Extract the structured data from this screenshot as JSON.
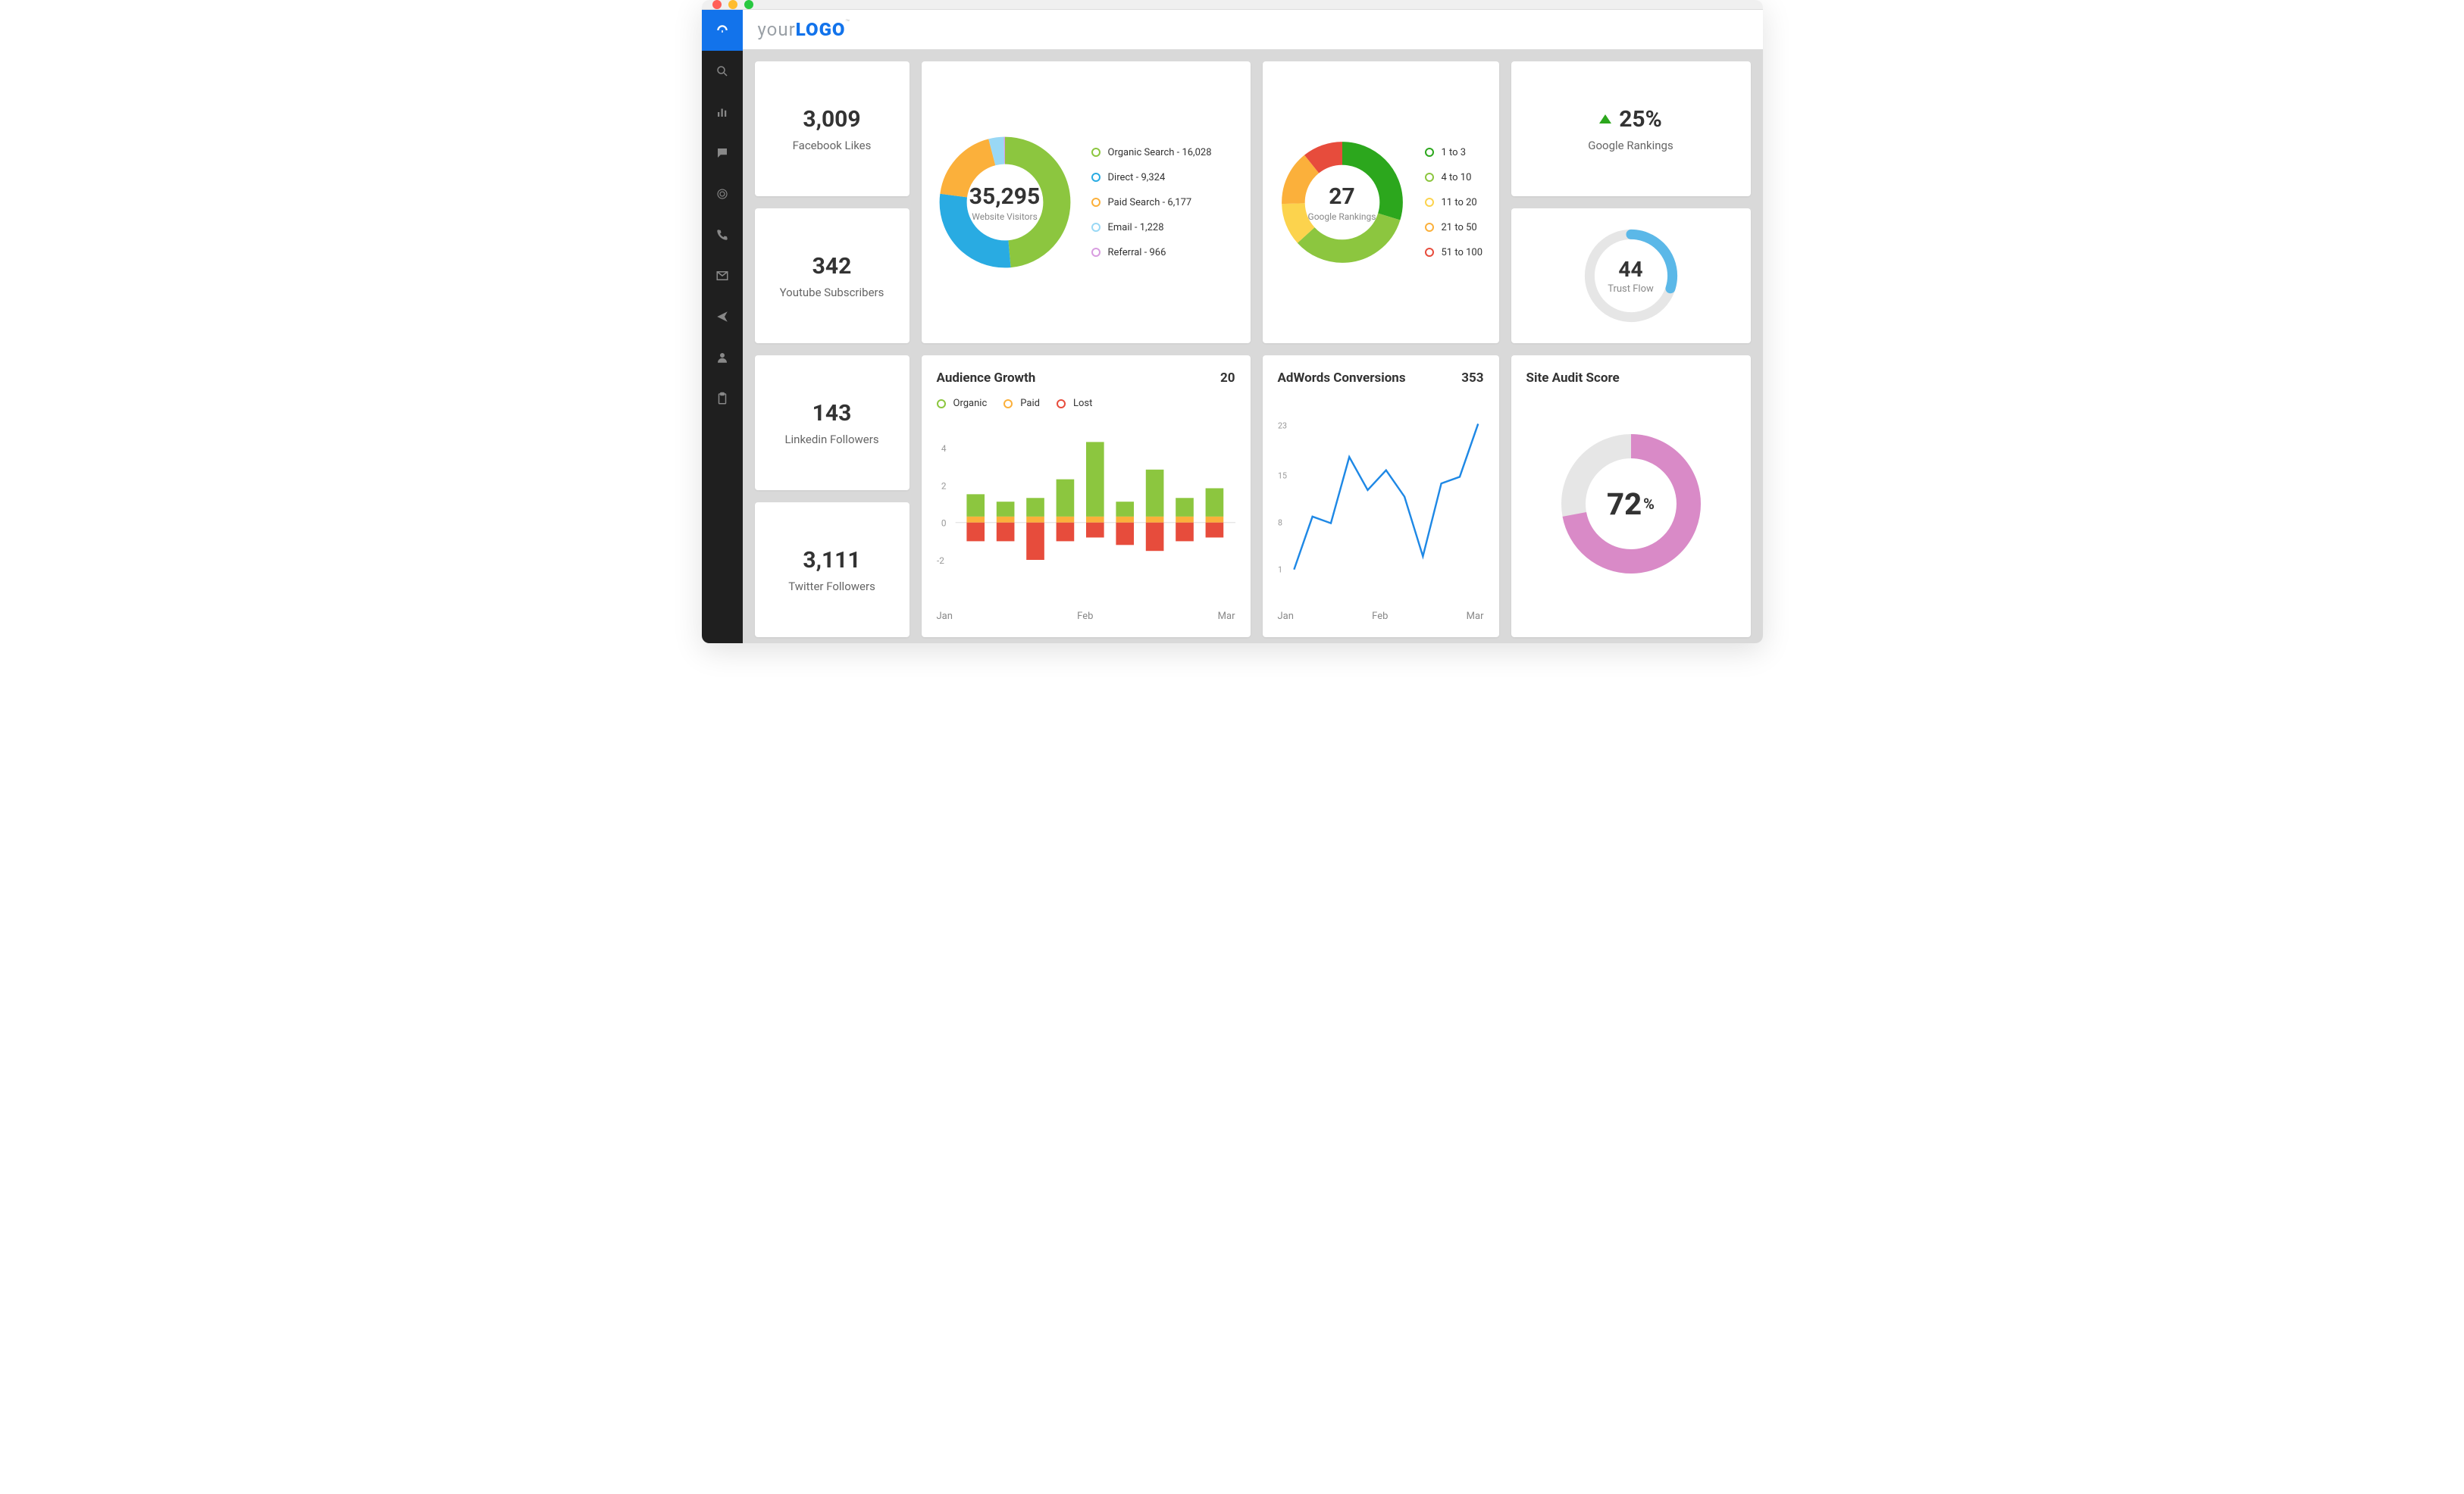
{
  "logo": {
    "prefix": "your",
    "main": "LOGO",
    "tm": "™"
  },
  "stats": {
    "fb": {
      "value": "3,009",
      "label": "Facebook Likes"
    },
    "yt": {
      "value": "342",
      "label": "Youtube Subscribers"
    },
    "li": {
      "value": "143",
      "label": "Linkedin Followers"
    },
    "tw": {
      "value": "3,111",
      "label": "Twitter Followers"
    }
  },
  "website_visitors": {
    "total": "35,295",
    "label": "Website Visitors",
    "items": [
      {
        "label": "Organic Search - 16,028",
        "color": "#8cc63f"
      },
      {
        "label": "Direct - 9,324",
        "color": "#29abe2"
      },
      {
        "label": "Paid Search - 6,177",
        "color": "#fbb03b"
      },
      {
        "label": "Email - 1,228",
        "color": "#99d8f5"
      },
      {
        "label": "Referral - 966",
        "color": "#d89de0"
      }
    ]
  },
  "google_rankings": {
    "total": "27",
    "label": "Google Rankings",
    "items": [
      {
        "label": "1 to 3",
        "color": "#2ca71d"
      },
      {
        "label": "4 to 10",
        "color": "#8cc63f"
      },
      {
        "label": "11 to 20",
        "color": "#fcd34d"
      },
      {
        "label": "21 to 50",
        "color": "#fbb03b"
      },
      {
        "label": "51 to 100",
        "color": "#e74c3c"
      }
    ]
  },
  "rank_change": {
    "value": "25%",
    "label": "Google Rankings"
  },
  "trust_flow": {
    "value": "44",
    "label": "Trust Flow",
    "percent": 30
  },
  "audience_growth": {
    "title": "Audience Growth",
    "value": "20",
    "legend": [
      {
        "label": "Organic",
        "color": "#8cc63f"
      },
      {
        "label": "Paid",
        "color": "#fbb03b"
      },
      {
        "label": "Lost",
        "color": "#e74c3c"
      }
    ],
    "x": [
      "Jan",
      "Feb",
      "Mar"
    ]
  },
  "adwords": {
    "title": "AdWords Conversions",
    "value": "353",
    "x": [
      "Jan",
      "Feb",
      "Mar"
    ],
    "yticks": [
      "23",
      "15",
      "8",
      "1"
    ]
  },
  "site_audit": {
    "title": "Site Audit Score",
    "value": "72",
    "suffix": "%",
    "percent": 72
  },
  "chart_data": [
    {
      "type": "pie",
      "title": "Website Visitors",
      "series": [
        {
          "name": "Organic Search",
          "value": 16028
        },
        {
          "name": "Direct",
          "value": 9324
        },
        {
          "name": "Paid Search",
          "value": 6177
        },
        {
          "name": "Email",
          "value": 1228
        },
        {
          "name": "Referral",
          "value": 966
        }
      ],
      "total": 35295
    },
    {
      "type": "pie",
      "title": "Google Rankings",
      "series": [
        {
          "name": "1 to 3",
          "value": 8
        },
        {
          "name": "4 to 10",
          "value": 9
        },
        {
          "name": "11 to 20",
          "value": 3
        },
        {
          "name": "21 to 50",
          "value": 4
        },
        {
          "name": "51 to 100",
          "value": 3
        }
      ],
      "total": 27
    },
    {
      "type": "bar",
      "title": "Audience Growth",
      "categories": [
        "Jan",
        "",
        "",
        "",
        "Feb",
        "",
        "",
        "",
        "Mar"
      ],
      "series": [
        {
          "name": "Organic",
          "values": [
            1.2,
            0.8,
            1.0,
            2.0,
            4.0,
            0.8,
            2.5,
            1.0,
            1.5
          ]
        },
        {
          "name": "Paid",
          "values": [
            0.3,
            0.3,
            0.3,
            0.3,
            0.3,
            0.3,
            0.3,
            0.3,
            0.3
          ]
        },
        {
          "name": "Lost",
          "values": [
            -1.0,
            -1.0,
            -2.0,
            -1.0,
            -0.8,
            -1.2,
            -1.5,
            -1.0,
            -0.8
          ]
        }
      ],
      "ylim": [
        -2,
        4
      ],
      "xlabel": "",
      "ylabel": ""
    },
    {
      "type": "line",
      "title": "AdWords Conversions",
      "x": [
        0,
        1,
        2,
        3,
        4,
        5,
        6,
        7,
        8,
        9,
        10
      ],
      "values": [
        1,
        9,
        8,
        18,
        13,
        16,
        12,
        3,
        14,
        15,
        23
      ],
      "ylim": [
        1,
        23
      ],
      "xlabel": "",
      "ylabel": "",
      "total": 353
    },
    {
      "type": "pie",
      "title": "Trust Flow",
      "values": [
        44
      ],
      "max": 147
    },
    {
      "type": "pie",
      "title": "Site Audit Score",
      "values": [
        72
      ],
      "max": 100
    }
  ]
}
